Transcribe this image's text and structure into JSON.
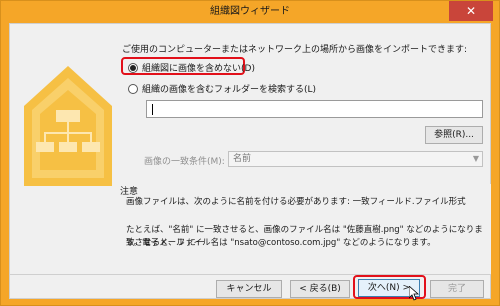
{
  "window": {
    "title": "組織図ウィザード",
    "close_glyph": "✕"
  },
  "main": {
    "instruction": "ご使用のコンピューターまたはネットワーク上の場所から画像をインポートできます:",
    "option_no_images": "組織図に画像を含めない(D)",
    "option_search_folder": "組織の画像を含むフォルダーを検索する(L)",
    "folder_path_value": "",
    "browse_button": "参照(R)...",
    "match_label": "画像の一致条件(M):",
    "match_select_value": "名前",
    "selected_option": "no_images"
  },
  "note": {
    "title": "注意",
    "line1": "画像ファイルは、次のように名前を付ける必要があります: 一致フィールド.ファイル形式",
    "line2": "たとえば、\"名前\" に一致させると、画像のファイル名は \"佐藤直樹.png\" などのようになります。電子メール に一",
    "line3": "致させると、ファイル名は \"nsato@contoso.com.jpg\" などのようになります。"
  },
  "footer": {
    "cancel": "キャンセル",
    "back": "< 戻る(B)",
    "next": "次へ(N) >",
    "finish": "完了"
  },
  "colors": {
    "frame": "#f5a628",
    "highlight": "#e2101a"
  }
}
